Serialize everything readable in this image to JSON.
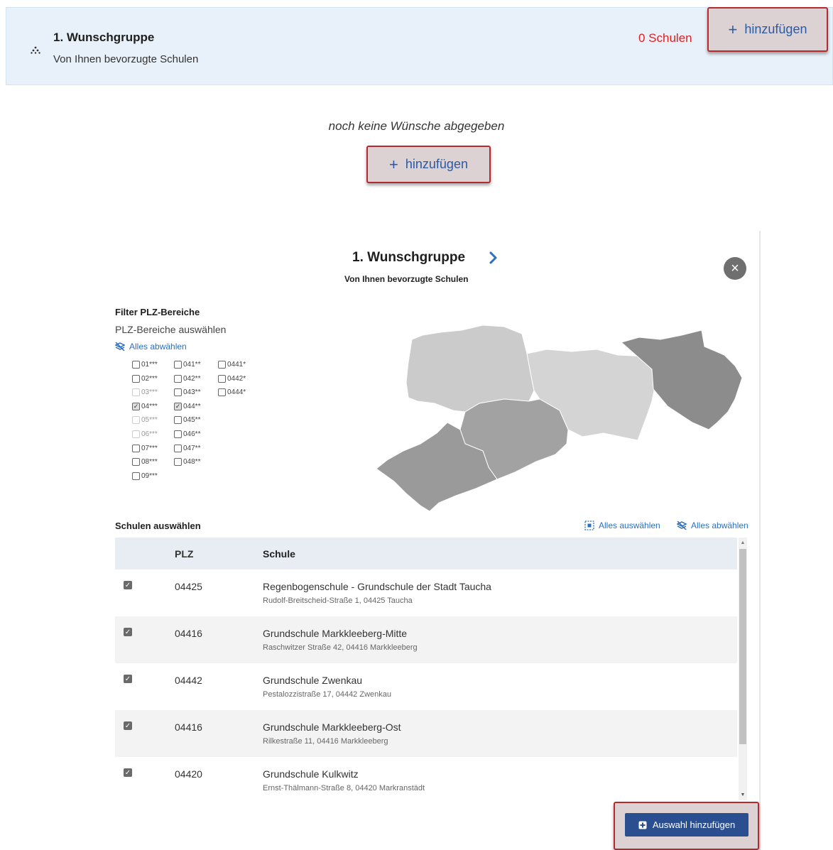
{
  "banner": {
    "title": "1. Wunschgruppe",
    "subtitle": "Von Ihnen bevorzugte Schulen",
    "count": "0 Schulen",
    "add_label": "hinzufügen",
    "collapse_icon": "chevron-up-icon"
  },
  "empty": {
    "message": "noch keine Wünsche abgegeben",
    "add_label": "hinzufügen"
  },
  "modal": {
    "title": "1. Wunschgruppe",
    "subtitle": "Von Ihnen bevorzugte Schulen",
    "close_glyph": "×",
    "filter": {
      "heading": "Filter PLZ-Bereiche",
      "subheading": "PLZ-Bereiche auswählen",
      "clear_label": "Alles abwählen",
      "options": [
        {
          "label": "01***",
          "checked": false,
          "disabled": false
        },
        {
          "label": "02***",
          "checked": false,
          "disabled": false
        },
        {
          "label": "03***",
          "checked": false,
          "disabled": true
        },
        {
          "label": "04***",
          "checked": true,
          "disabled": false
        },
        {
          "label": "05***",
          "checked": false,
          "disabled": true
        },
        {
          "label": "06***",
          "checked": false,
          "disabled": true
        },
        {
          "label": "07***",
          "checked": false,
          "disabled": false
        },
        {
          "label": "08***",
          "checked": false,
          "disabled": false
        },
        {
          "label": "09***",
          "checked": false,
          "disabled": false
        },
        {
          "label": "041**",
          "checked": false,
          "disabled": false
        },
        {
          "label": "042**",
          "checked": false,
          "disabled": false
        },
        {
          "label": "043**",
          "checked": false,
          "disabled": false
        },
        {
          "label": "044**",
          "checked": true,
          "disabled": false
        },
        {
          "label": "045**",
          "checked": false,
          "disabled": false
        },
        {
          "label": "046**",
          "checked": false,
          "disabled": false
        },
        {
          "label": "047**",
          "checked": false,
          "disabled": false
        },
        {
          "label": "048**",
          "checked": false,
          "disabled": false
        },
        {
          "label": "0441*",
          "checked": false,
          "disabled": false
        },
        {
          "label": "0442*",
          "checked": false,
          "disabled": false
        },
        {
          "label": "0444*",
          "checked": false,
          "disabled": false
        }
      ]
    },
    "schools": {
      "heading": "Schulen auswählen",
      "select_all_label": "Alles auswählen",
      "deselect_all_label": "Alles abwählen",
      "columns": {
        "plz": "PLZ",
        "school": "Schule"
      },
      "rows": [
        {
          "checked": true,
          "plz": "04425",
          "name": "Regenbogenschule - Grundschule der Stadt Taucha",
          "address": "Rudolf-Breitscheid-Straße 1, 04425 Taucha"
        },
        {
          "checked": true,
          "plz": "04416",
          "name": "Grundschule Markkleeberg-Mitte",
          "address": "Raschwitzer Straße 42, 04416 Markkleeberg"
        },
        {
          "checked": true,
          "plz": "04442",
          "name": "Grundschule Zwenkau",
          "address": "Pestalozzistraße 17, 04442 Zwenkau"
        },
        {
          "checked": true,
          "plz": "04416",
          "name": "Grundschule Markkleeberg-Ost",
          "address": "Rilkestraße 11, 04416 Markkleeberg"
        },
        {
          "checked": true,
          "plz": "04420",
          "name": "Grundschule Kulkwitz",
          "address": "Ernst-Thälmann-Straße 8, 04420 Markranstädt"
        }
      ]
    },
    "submit_label": "Auswahl hinzufügen"
  },
  "colors": {
    "accent": "#2c6fc0",
    "button_primary": "#2b4e91",
    "highlight_border": "#b52a2f",
    "count_red": "#e02020",
    "banner_bg": "#e8f1f9"
  }
}
